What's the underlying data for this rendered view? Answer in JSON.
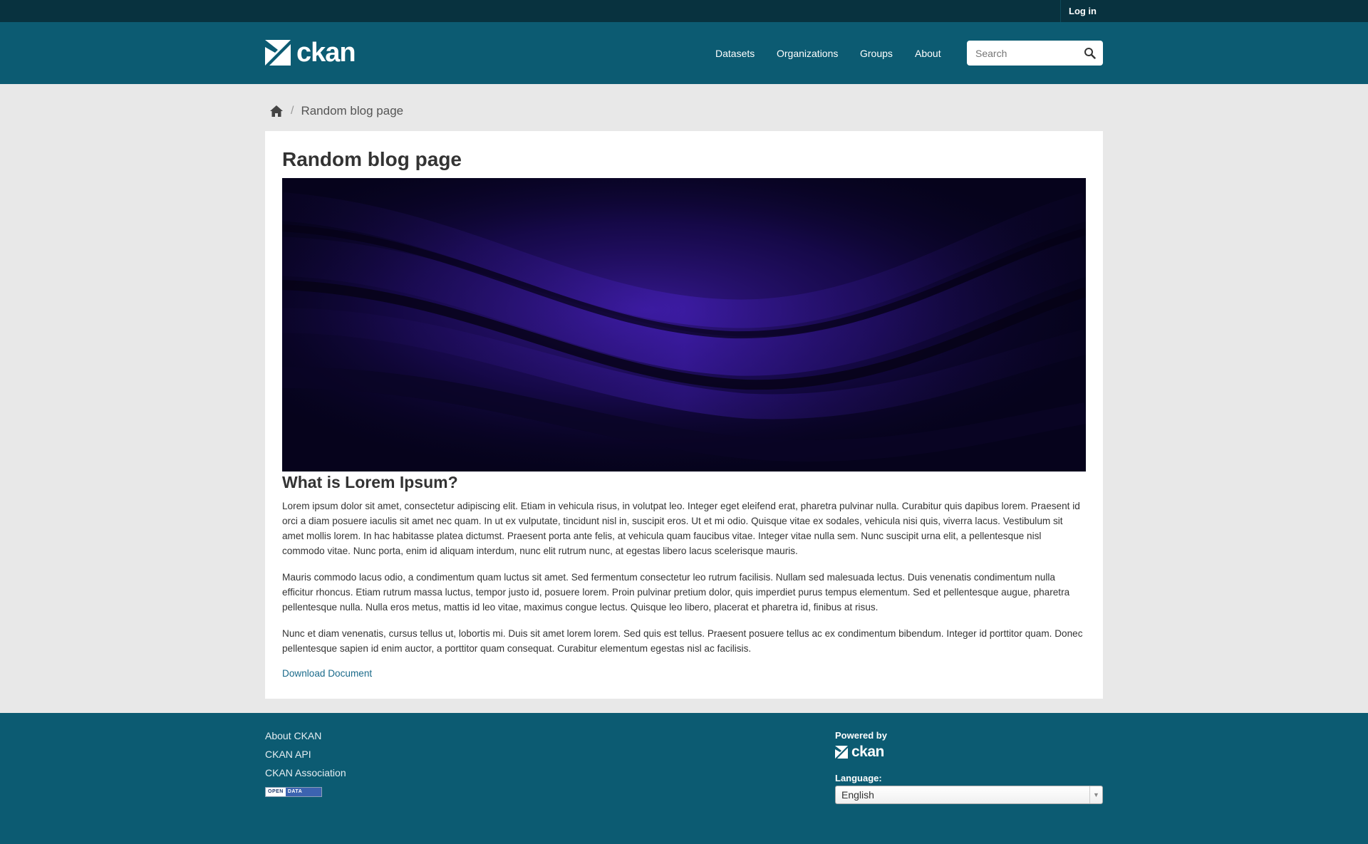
{
  "topbar": {
    "login_label": "Log in"
  },
  "header": {
    "logo_text": "ckan",
    "nav": [
      {
        "label": "Datasets"
      },
      {
        "label": "Organizations"
      },
      {
        "label": "Groups"
      },
      {
        "label": "About"
      }
    ],
    "search_placeholder": "Search"
  },
  "breadcrumb": {
    "current": "Random blog page",
    "separator": "/"
  },
  "page": {
    "title": "Random blog page",
    "heading": "What is Lorem Ipsum?",
    "paragraphs": [
      "Lorem ipsum dolor sit amet, consectetur adipiscing elit. Etiam in vehicula risus, in volutpat leo. Integer eget eleifend erat, pharetra pulvinar nulla. Curabitur quis dapibus lorem. Praesent id orci a diam posuere iaculis sit amet nec quam. In ut ex vulputate, tincidunt nisl in, suscipit eros. Ut et mi odio. Quisque vitae ex sodales, vehicula nisi quis, viverra lacus. Vestibulum sit amet mollis lorem. In hac habitasse platea dictumst. Praesent porta ante felis, at vehicula quam faucibus vitae. Integer vitae nulla sem. Nunc suscipit urna elit, a pellentesque nisl commodo vitae. Nunc porta, enim id aliquam interdum, nunc elit rutrum nunc, at egestas libero lacus scelerisque mauris.",
      "Mauris commodo lacus odio, a condimentum quam luctus sit amet. Sed fermentum consectetur leo rutrum facilisis. Nullam sed malesuada lectus. Duis venenatis condimentum nulla efficitur rhoncus. Etiam rutrum massa luctus, tempor justo id, posuere lorem. Proin pulvinar pretium dolor, quis imperdiet purus tempus elementum. Sed et pellentesque augue, pharetra pellentesque nulla. Nulla eros metus, mattis id leo vitae, maximus congue lectus. Quisque leo libero, placerat et pharetra id, finibus at risus.",
      "Nunc et diam venenatis, cursus tellus ut, lobortis mi. Duis sit amet lorem lorem. Sed quis est tellus. Praesent posuere tellus ac ex condimentum bibendum. Integer id porttitor quam. Donec pellentesque sapien id enim auctor, a porttitor quam consequat. Curabitur elementum egestas nisl ac facilisis."
    ],
    "download_label": "Download Document"
  },
  "footer": {
    "links": [
      {
        "label": "About CKAN"
      },
      {
        "label": "CKAN API"
      },
      {
        "label": "CKAN Association"
      }
    ],
    "open_data_badge": {
      "left": "OPEN",
      "right": "DATA"
    },
    "powered_by": "Powered by",
    "logo_text": "ckan",
    "language_label": "Language:",
    "language_value": "English"
  },
  "colors": {
    "topbar": "#08323f",
    "masthead": "#0c5b72",
    "body_bg": "#e8e8e8",
    "link": "#1a6a8a"
  },
  "icons": [
    "ckan-logo-icon",
    "search-icon",
    "home-icon",
    "chevron-down-icon"
  ]
}
